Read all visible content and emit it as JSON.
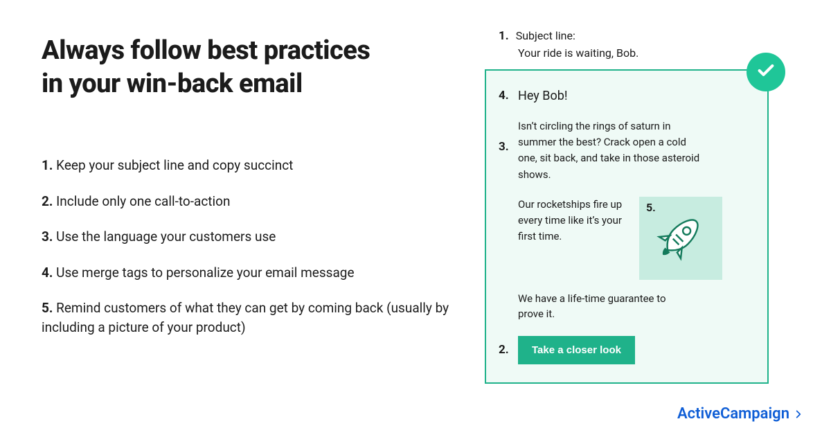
{
  "headline_l1": "Always follow best practices",
  "headline_l2": "in your win-back email",
  "practices": [
    "Keep your subject line and copy succinct",
    "Include only one call-to-action",
    "Use the language your customers use",
    "Use merge tags to personalize your email message",
    " Remind customers of what they can get by coming back (usually by including a picture of your product)"
  ],
  "nums": {
    "n1": "1.",
    "n2": "2.",
    "n3": "3.",
    "n4": "4.",
    "n5": "5."
  },
  "subject": {
    "label": "Subject line:",
    "value": "Your ride is waiting, Bob."
  },
  "email": {
    "greeting": "Hey Bob!",
    "p1": "Isn’t circling the rings of saturn in summer the best? Crack open a cold one, sit back, and take in those asteroid shows.",
    "p2": "Our rocketships fire up every time like it’s your first time.",
    "p3": "We have a life-time guarantee to prove it.",
    "cta": "Take a closer look"
  },
  "brand": "ActiveCampaign"
}
